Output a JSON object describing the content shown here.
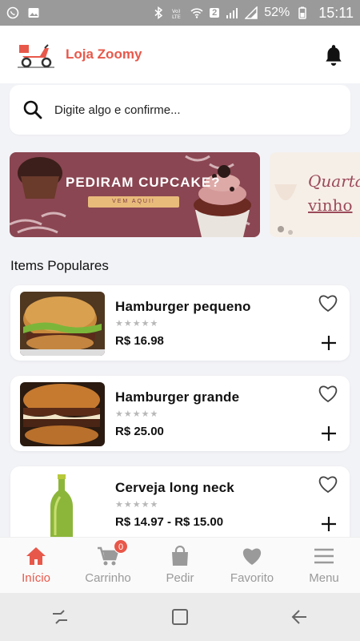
{
  "status_bar": {
    "battery": "52%",
    "time": "15:11",
    "notif_count": "2"
  },
  "header": {
    "brand": "Loja Zoomy"
  },
  "search": {
    "placeholder": "Digite algo e confirme..."
  },
  "banners": [
    {
      "title": "PEDIRAM CUPCAKE?",
      "button": "VEM AQUI!"
    },
    {
      "line1": "Quarta",
      "line2": "vinho"
    }
  ],
  "section": {
    "title": "Items Populares"
  },
  "products": [
    {
      "name": "Hamburger pequeno",
      "stars": "★★★★★",
      "price": "R$ 16.98"
    },
    {
      "name": "Hamburger grande",
      "stars": "★★★★★",
      "price": "R$ 25.00"
    },
    {
      "name": "Cerveja long neck",
      "stars": "★★★★★",
      "price": "R$ 14.97 - R$ 15.00"
    }
  ],
  "bottom_nav": [
    {
      "label": "Início",
      "icon": "home-icon"
    },
    {
      "label": "Carrinho",
      "icon": "cart-icon",
      "badge": "0"
    },
    {
      "label": "Pedir",
      "icon": "bag-icon"
    },
    {
      "label": "Favorito",
      "icon": "heart-icon"
    },
    {
      "label": "Menu",
      "icon": "menu-icon"
    }
  ],
  "colors": {
    "accent": "#e8584a",
    "inactive": "#9a9a9a",
    "background": "#f2f3f7"
  }
}
